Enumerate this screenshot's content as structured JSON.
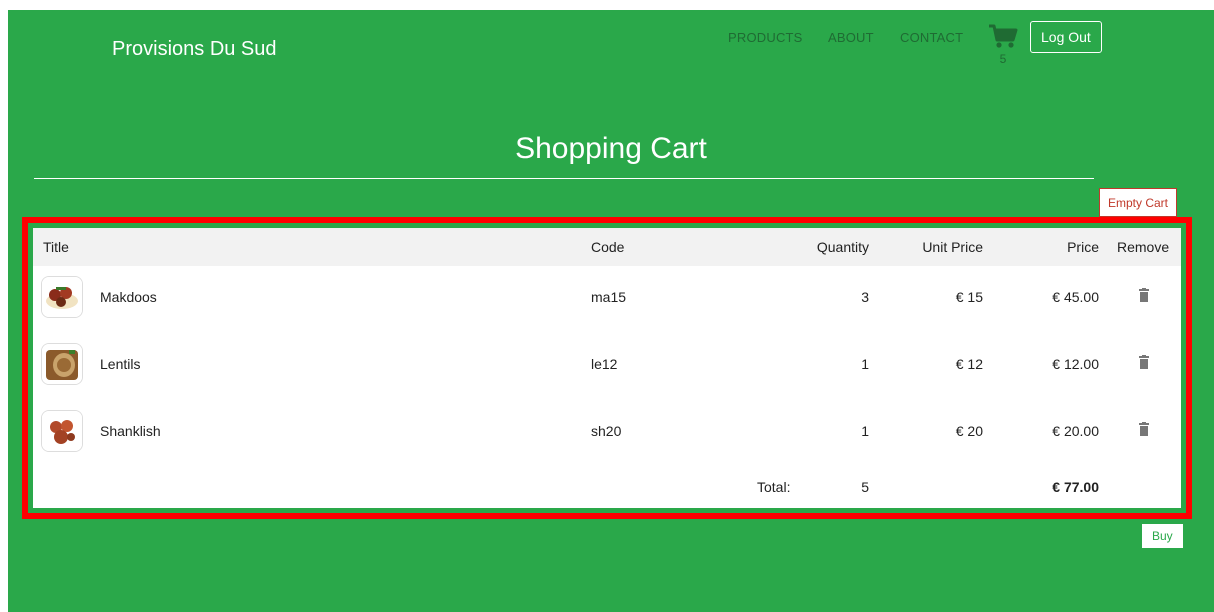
{
  "header": {
    "brand": "Provisions Du Sud",
    "nav": {
      "products": "PRODUCTS",
      "about": "ABOUT",
      "contact": "CONTACT"
    },
    "cart_count": "5",
    "logout_label": "Log Out"
  },
  "page": {
    "title": "Shopping Cart",
    "empty_cart_label": "Empty Cart",
    "buy_label": "Buy"
  },
  "table": {
    "headers": {
      "title": "Title",
      "code": "Code",
      "quantity": "Quantity",
      "unit_price": "Unit Price",
      "price": "Price",
      "remove": "Remove"
    },
    "rows": [
      {
        "title": "Makdoos",
        "code": "ma15",
        "quantity": "3",
        "unit_price": "€ 15",
        "price": "€ 45.00"
      },
      {
        "title": "Lentils",
        "code": "le12",
        "quantity": "1",
        "unit_price": "€ 12",
        "price": "€ 12.00"
      },
      {
        "title": "Shanklish",
        "code": "sh20",
        "quantity": "1",
        "unit_price": "€ 20",
        "price": "€ 20.00"
      }
    ],
    "total": {
      "label": "Total:",
      "quantity": "5",
      "price": "€ 77.00"
    }
  },
  "colors": {
    "page_bg": "#2aa84a",
    "nav_text": "#1f6b33",
    "highlight_border": "#ff0000",
    "danger": "#c0392b"
  },
  "icons": {
    "cart": "cart-icon",
    "remove": "trash-icon"
  }
}
